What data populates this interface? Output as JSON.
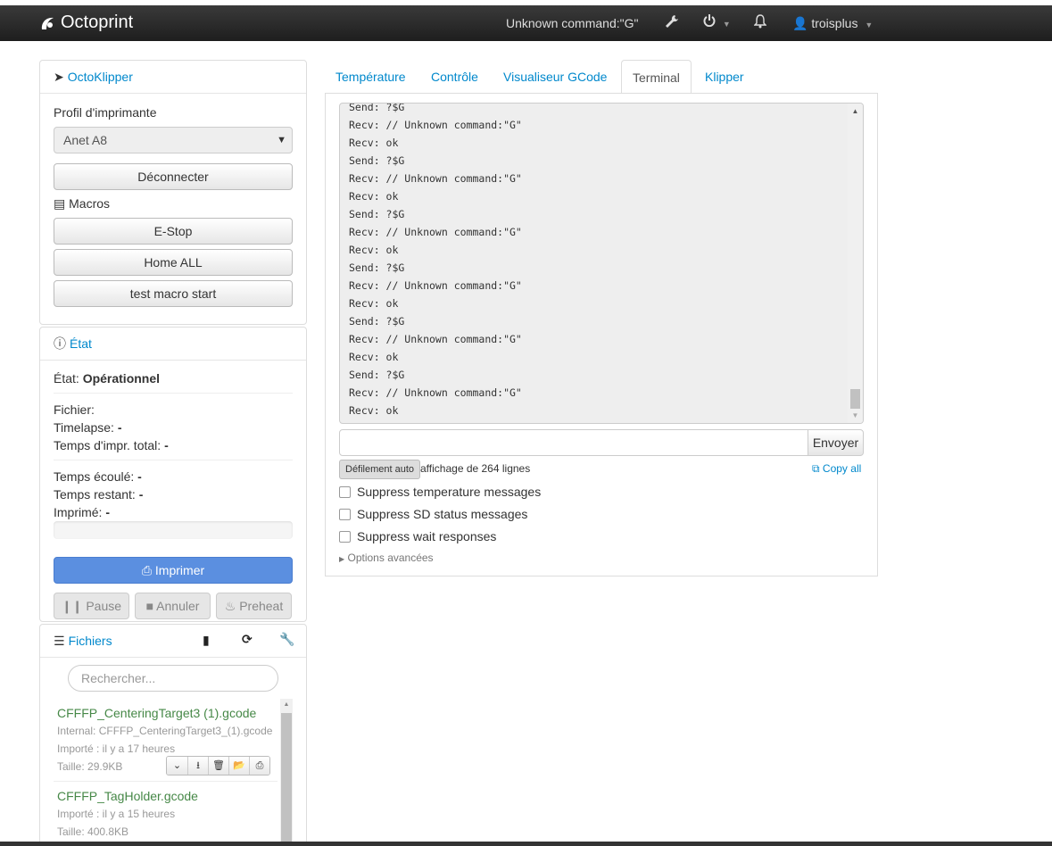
{
  "navbar": {
    "brand": "Octoprint",
    "status": "Unknown command:\"G\"",
    "user": "troisplus"
  },
  "octoklipper": {
    "title": "OctoKlipper",
    "profile_label": "Profil d'imprimante",
    "profile_value": "Anet A8",
    "disconnect": "Déconnecter",
    "macros_label": "Macros",
    "macros": [
      "E-Stop",
      "Home ALL",
      "test macro start"
    ]
  },
  "state": {
    "title": "État",
    "state_label": "État:",
    "state_value": "Opérationnel",
    "file_label": "Fichier:",
    "timelapse_label": "Timelapse:",
    "timelapse_value": "-",
    "total_label": "Temps d'impr. total:",
    "total_value": "-",
    "elapsed_label": "Temps écoulé:",
    "elapsed_value": "-",
    "remaining_label": "Temps restant:",
    "remaining_value": "-",
    "printed_label": "Imprimé:",
    "printed_value": "-",
    "progress": 0,
    "print_button": "Imprimer",
    "pause_button": "Pause",
    "cancel_button": "Annuler",
    "preheat_button": "Preheat"
  },
  "files": {
    "title": "Fichiers",
    "search_placeholder": "Rechercher...",
    "items": [
      {
        "name": "CFFFP_CenteringTarget3 (1).gcode",
        "internal": "Internal: CFFFP_CenteringTarget3_(1).gcode",
        "imported": "Importé : il y a 17 heures",
        "size": "Taille: 29.9KB"
      },
      {
        "name": "CFFFP_TagHolder.gcode",
        "imported": "Importé : il y a 15 heures",
        "size": "Taille: 400.8KB"
      }
    ]
  },
  "tabs": [
    "Température",
    "Contrôle",
    "Visualiseur GCode",
    "Terminal",
    "Klipper"
  ],
  "active_tab": "Terminal",
  "terminal": {
    "lines": [
      "Send: ?$G",
      "Recv: // Unknown command:\"G\"",
      "Recv: ok",
      "Send: ?$G",
      "Recv: // Unknown command:\"G\"",
      "Recv: ok",
      "Send: ?$G",
      "Recv: // Unknown command:\"G\"",
      "Recv: ok",
      "Send: ?$G",
      "Recv: // Unknown command:\"G\"",
      "Recv: ok",
      "Send: ?$G",
      "Recv: // Unknown command:\"G\"",
      "Recv: ok",
      "Send: ?$G",
      "Recv: // Unknown command:\"G\"",
      "Recv: ok"
    ],
    "send_button": "Envoyer",
    "autoscroll": "Défilement auto",
    "lines_count": "affichage de 264 lignes",
    "copy_all": "Copy all",
    "checkboxes": [
      "Suppress temperature messages",
      "Suppress SD status messages",
      "Suppress wait responses"
    ],
    "advanced": "Options avancées"
  }
}
